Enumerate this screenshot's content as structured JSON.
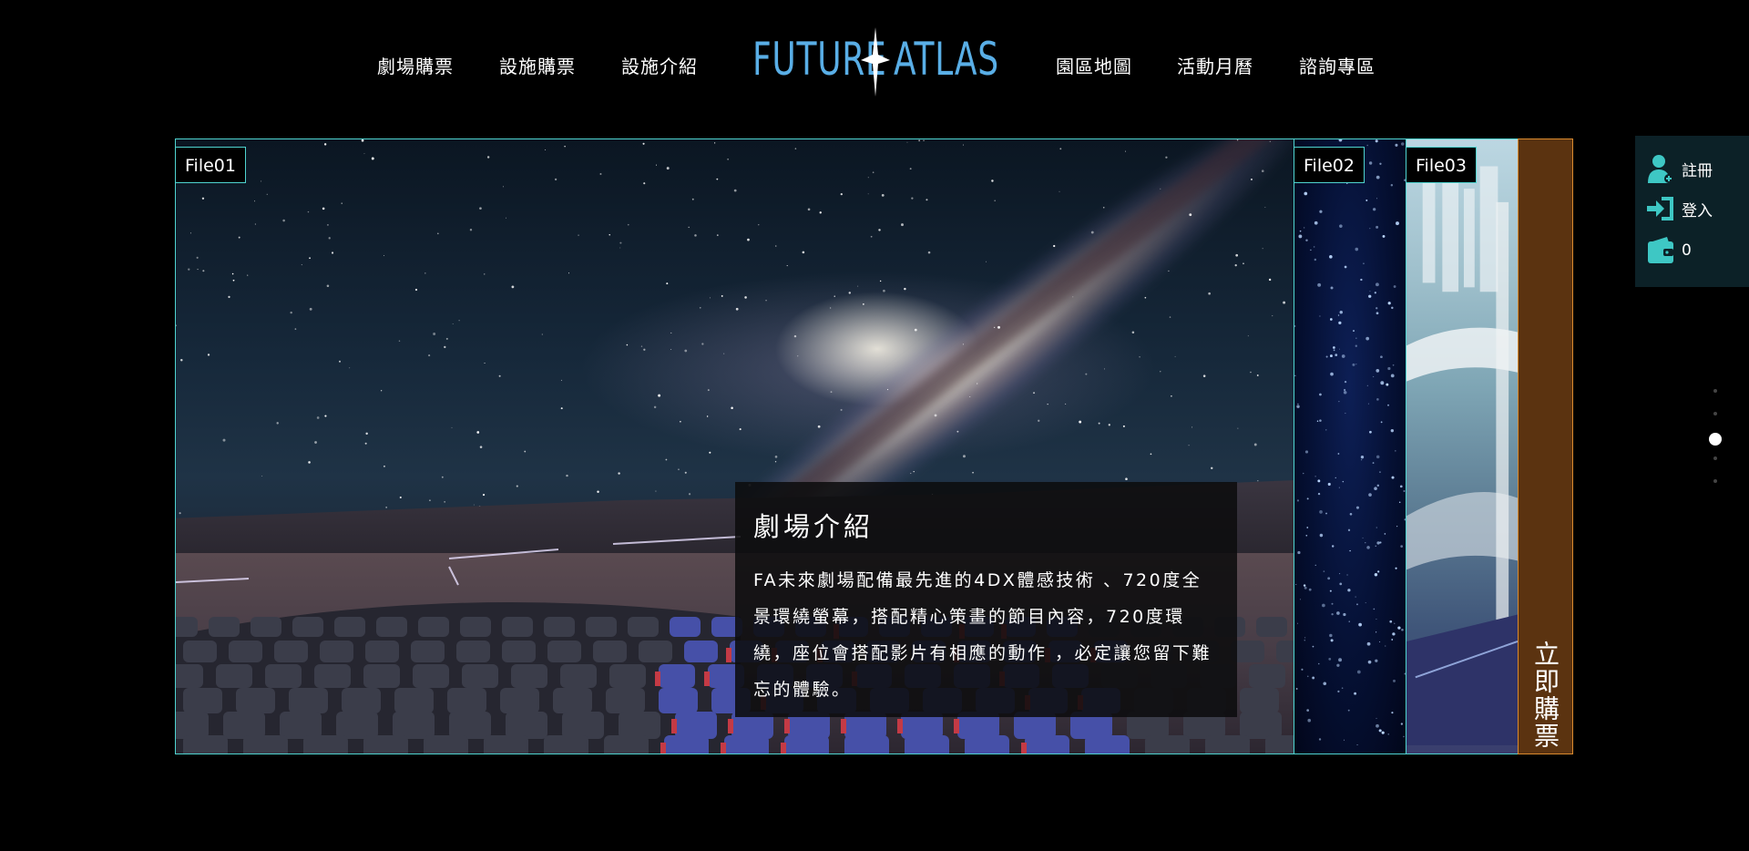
{
  "nav": {
    "left_links": [
      "劇場購票",
      "設施購票",
      "設施介紹"
    ],
    "right_links": [
      "園區地圖",
      "活動月曆",
      "諮詢專區"
    ],
    "logo": {
      "left_word": "FUTURE",
      "right_word": "ATLAS",
      "color": "#59aee6"
    }
  },
  "gallery": {
    "panels": [
      {
        "tag": "File01"
      },
      {
        "tag": "File02"
      },
      {
        "tag": "File03"
      }
    ],
    "caption": {
      "title": "劇場介紹",
      "body": "FA未來劇場配備最先進的4DX體感技術 、720度全景環繞螢幕，搭配精心策畫的節目內容，720度環繞，座位會搭配影片有相應的動作 ，必定讓您留下難忘的體驗。"
    },
    "buy_now": "立即購票",
    "accent_color": "#4fd4d0",
    "buy_color": "#5b3310"
  },
  "member": {
    "register": "註冊",
    "login": "登入",
    "wallet_count": "0",
    "icon_color": "#3ec7c4"
  },
  "pager": {
    "total": 5,
    "active": 3
  }
}
